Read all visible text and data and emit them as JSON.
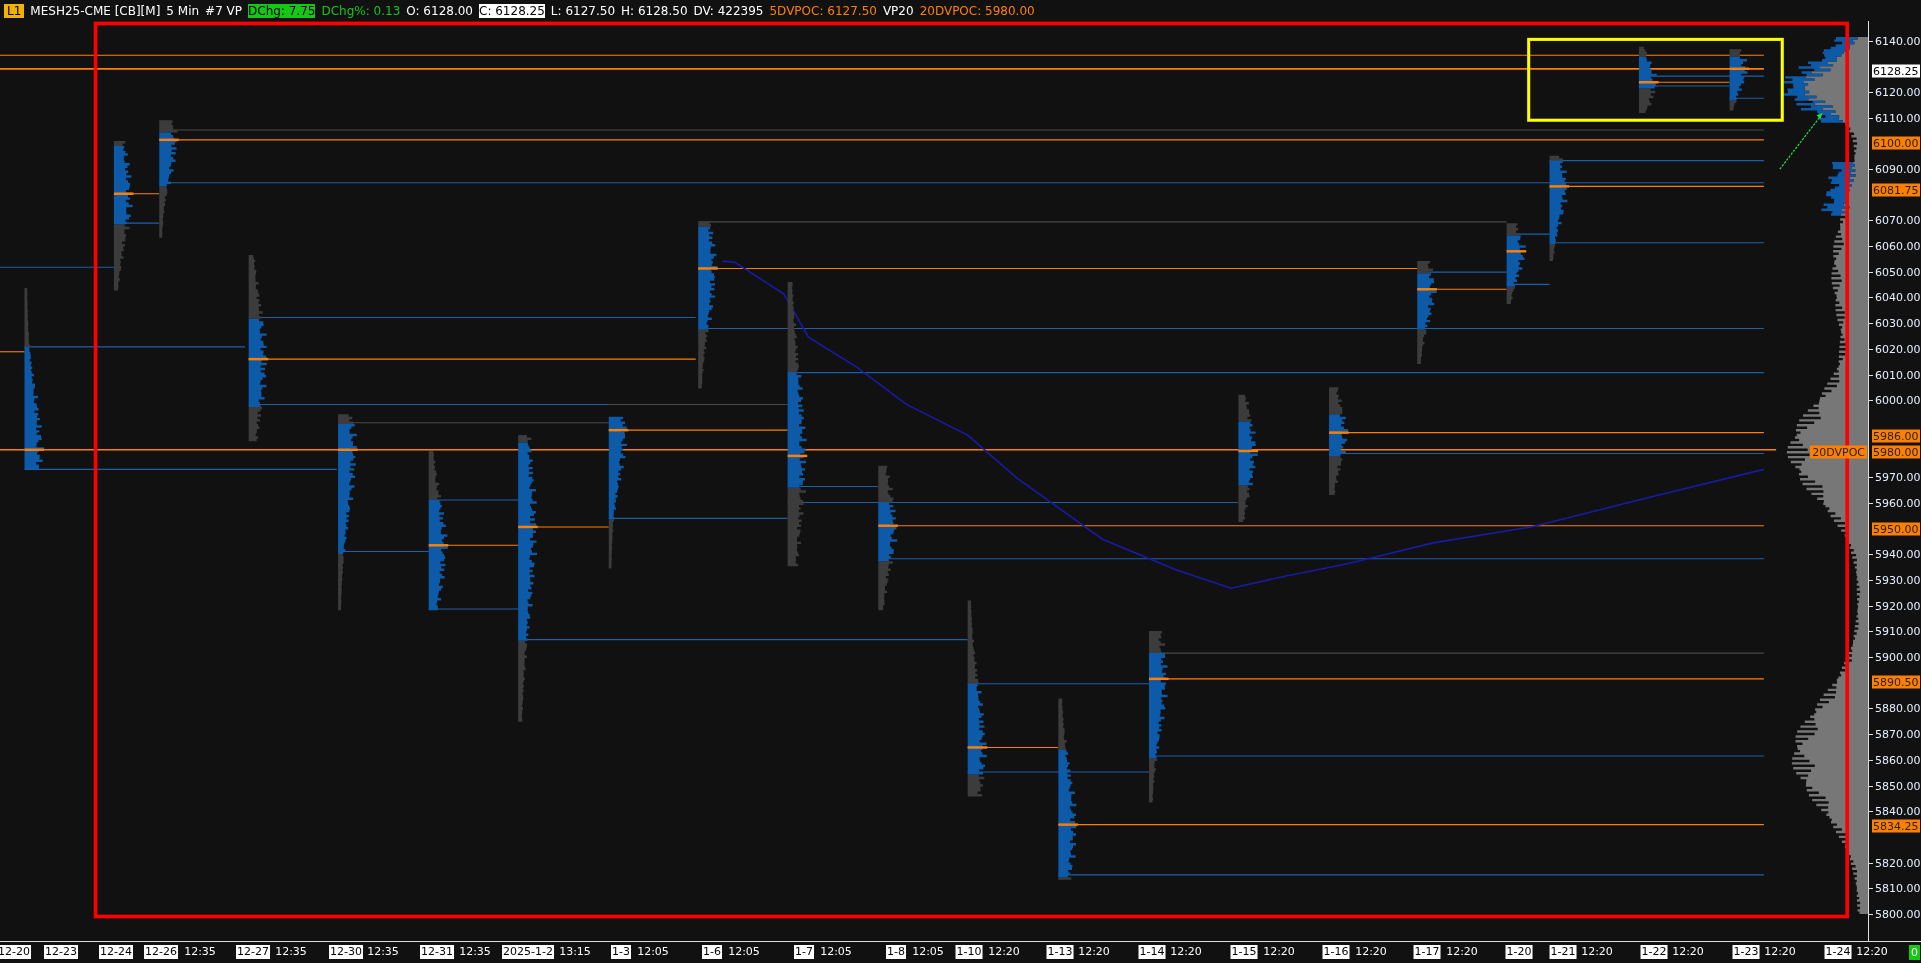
{
  "header": {
    "badge": "L1",
    "items": [
      {
        "text": "MESH25-CME [CB][M]",
        "kind": "plain"
      },
      {
        "text": "5 Min",
        "kind": "plain"
      },
      {
        "text": "#7 VP",
        "kind": "plain"
      },
      {
        "text": "DChg: 7.75",
        "kind": "green_box"
      },
      {
        "text": "DChg%: 0.13",
        "kind": "green"
      },
      {
        "text": "O: 6128.00",
        "kind": "plain"
      },
      {
        "text": "C: 6128.25",
        "kind": "white_box"
      },
      {
        "text": "L: 6127.50",
        "kind": "plain"
      },
      {
        "text": "H: 6128.50",
        "kind": "plain"
      },
      {
        "text": "DV: 422395",
        "kind": "plain"
      },
      {
        "text": "5DVPOC: 6127.50",
        "kind": "orange"
      },
      {
        "text": "VP20",
        "kind": "plain"
      },
      {
        "text": "20DVPOC: 5980.00",
        "kind": "orange"
      }
    ]
  },
  "price_axis": {
    "ticks": [
      "6140.00",
      "6120.00",
      "6110.00",
      "6090.00",
      "6070.00",
      "6060.00",
      "6050.00",
      "6040.00",
      "6030.00",
      "6020.00",
      "6010.00",
      "6000.00",
      "5970.00",
      "5960.00",
      "5940.00",
      "5930.00",
      "5920.00",
      "5910.00",
      "5900.00",
      "5880.00",
      "5870.00",
      "5860.00",
      "5850.00",
      "5840.00",
      "5820.00",
      "5810.00",
      "5800.00"
    ],
    "markers": [
      {
        "label": "6128.25",
        "kind": "last"
      },
      {
        "label": "6100.00",
        "kind": "level"
      },
      {
        "label": "6081.75",
        "kind": "level"
      },
      {
        "label": "5986.00",
        "kind": "level"
      },
      {
        "label": "5980.00",
        "kind": "level"
      },
      {
        "label": "5950.00",
        "kind": "level"
      },
      {
        "label": "5890.50",
        "kind": "level"
      },
      {
        "label": "5834.25",
        "kind": "level"
      }
    ]
  },
  "poc_tag": "20DVPOC",
  "time_axis": [
    {
      "text": "12-20",
      "kind": "date"
    },
    {
      "text": "12-23",
      "kind": "date"
    },
    {
      "text": "12-24",
      "kind": "date"
    },
    {
      "text": "12-26",
      "kind": "date"
    },
    {
      "text": "12:35",
      "kind": "time"
    },
    {
      "text": "12-27",
      "kind": "date"
    },
    {
      "text": "12:35",
      "kind": "time"
    },
    {
      "text": "12-30",
      "kind": "date"
    },
    {
      "text": "12:35",
      "kind": "time"
    },
    {
      "text": "12-31",
      "kind": "date"
    },
    {
      "text": "12:35",
      "kind": "time"
    },
    {
      "text": "2025-1-2",
      "kind": "date"
    },
    {
      "text": "13:15",
      "kind": "time"
    },
    {
      "text": "1-3",
      "kind": "date"
    },
    {
      "text": "12:05",
      "kind": "time"
    },
    {
      "text": "1-6",
      "kind": "date"
    },
    {
      "text": "12:05",
      "kind": "time"
    },
    {
      "text": "1-7",
      "kind": "date"
    },
    {
      "text": "12:05",
      "kind": "time"
    },
    {
      "text": "1-8",
      "kind": "date"
    },
    {
      "text": "12:05",
      "kind": "time"
    },
    {
      "text": "1-10",
      "kind": "date"
    },
    {
      "text": "12:20",
      "kind": "time"
    },
    {
      "text": "1-13",
      "kind": "date"
    },
    {
      "text": "12:20",
      "kind": "time"
    },
    {
      "text": "1-14",
      "kind": "date"
    },
    {
      "text": "12:20",
      "kind": "time"
    },
    {
      "text": "1-15",
      "kind": "date"
    },
    {
      "text": "12:20",
      "kind": "time"
    },
    {
      "text": "1-16",
      "kind": "date"
    },
    {
      "text": "12:20",
      "kind": "time"
    },
    {
      "text": "1-17",
      "kind": "date"
    },
    {
      "text": "12:20",
      "kind": "time"
    },
    {
      "text": "1-20",
      "kind": "date"
    },
    {
      "text": "1-21",
      "kind": "date"
    },
    {
      "text": "12:20",
      "kind": "time"
    },
    {
      "text": "1-22",
      "kind": "date"
    },
    {
      "text": "12:20",
      "kind": "time"
    },
    {
      "text": "1-23",
      "kind": "date"
    },
    {
      "text": "12:20",
      "kind": "time"
    },
    {
      "text": "1-24",
      "kind": "date"
    },
    {
      "text": "12:20",
      "kind": "time"
    }
  ],
  "status": "0"
}
